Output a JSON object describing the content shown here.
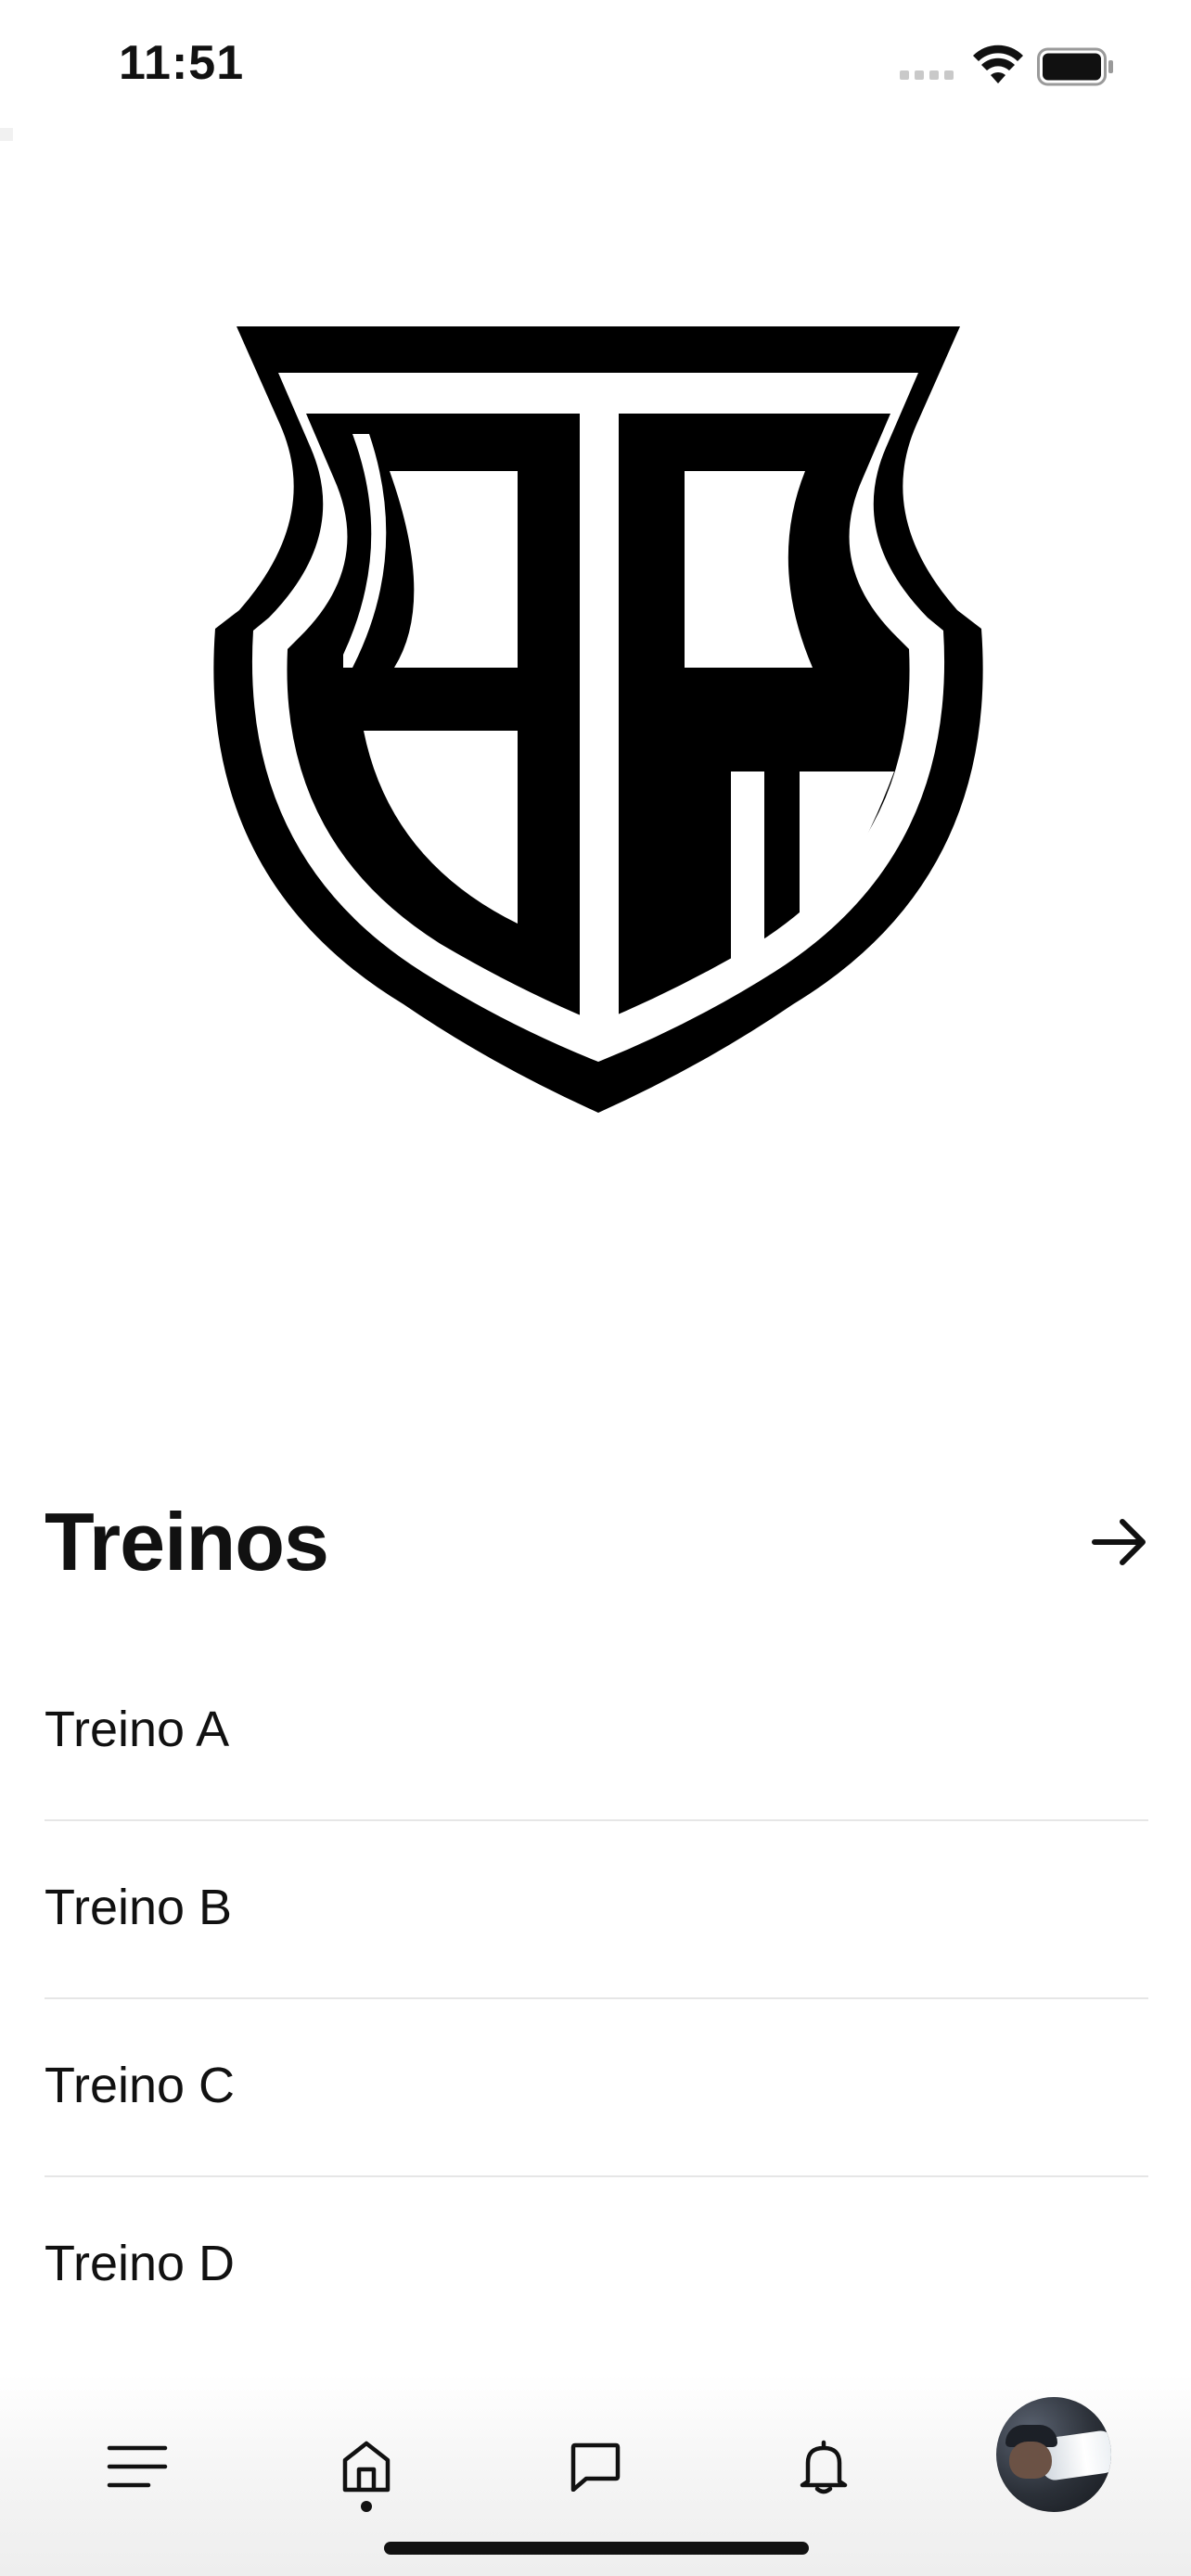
{
  "status_bar": {
    "time": "11:51",
    "icons": [
      "cellular-signal-icon",
      "wifi-icon",
      "battery-icon"
    ]
  },
  "logo": {
    "name": "brand-shield-logo",
    "color": "#000000"
  },
  "section": {
    "title": "Treinos",
    "arrow_icon": "arrow-right-icon"
  },
  "workouts": [
    {
      "label": "Treino A"
    },
    {
      "label": "Treino B"
    },
    {
      "label": "Treino C"
    },
    {
      "label": "Treino D"
    }
  ],
  "tab_bar": {
    "tabs": [
      {
        "icon": "menu-icon"
      },
      {
        "icon": "home-icon",
        "active": true
      },
      {
        "icon": "chat-icon"
      },
      {
        "icon": "bell-icon"
      },
      {
        "icon": "profile-avatar"
      }
    ]
  },
  "colors": {
    "background": "#ffffff",
    "text": "#111111",
    "divider": "#e6e6e6",
    "tab_bar": "#f1f1f1"
  }
}
